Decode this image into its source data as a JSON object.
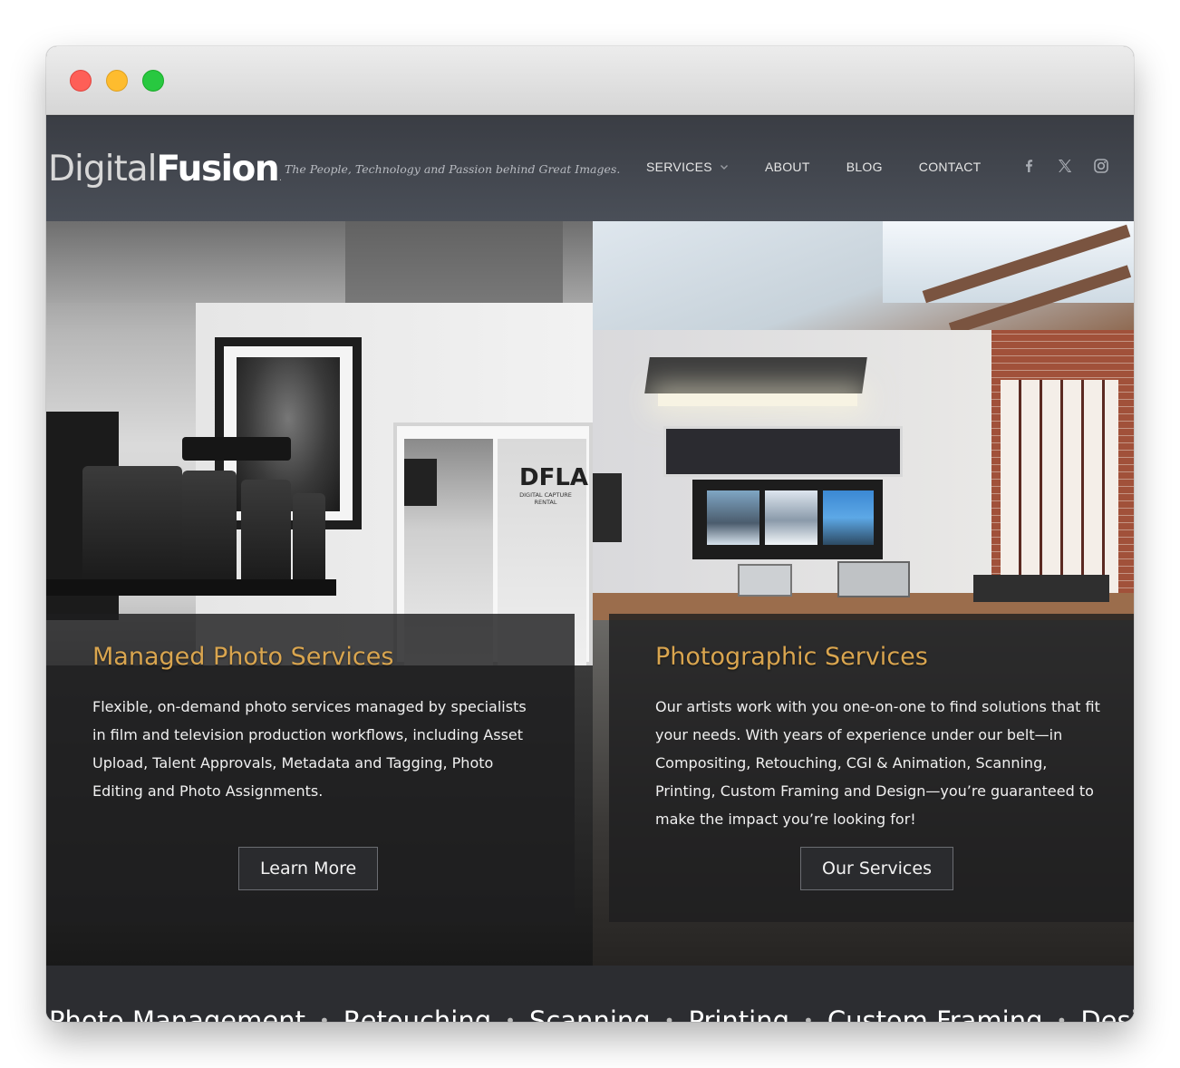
{
  "window": {
    "controls": [
      "close",
      "minimize",
      "zoom"
    ]
  },
  "header": {
    "logo_light": "Digital",
    "logo_bold": "Fusion",
    "logo_mark": ".",
    "tagline": "The People, Technology and Passion behind Great Images.",
    "nav": {
      "services": "SERVICES",
      "about": "ABOUT",
      "blog": "BLOG",
      "contact": "CONTACT"
    },
    "social_icons": [
      "facebook-icon",
      "x-icon",
      "instagram-icon"
    ]
  },
  "hero": {
    "left": {
      "title": "Managed Photo Services",
      "text": "Flexible, on-demand photo services managed by specialists in film and television production workflows, including Asset Upload, Talent Approvals, Metadata and Tagging, Photo Editing and Photo Assignments.",
      "button": "Learn More",
      "photo_sign": "DFLA",
      "photo_sign_sub": "DIGITAL CAPTURE RENTAL"
    },
    "right": {
      "title": "Photographic Services",
      "text": "Our artists work with you one-on-one to find solutions that fit your needs. With years of experience under our belt—in Compositing, Retouching, CGI & Animation, Scanning, Printing, Custom Framing and Design—you’re guaranteed to make the impact you’re looking for!",
      "button": "Our Services"
    }
  },
  "ticker": {
    "items": [
      "Photo Management",
      "Retouching",
      "Scanning",
      "Printing",
      "Custom Framing",
      "Design"
    ],
    "separator": "•"
  },
  "colors": {
    "accent_gold": "#d9a54f",
    "header_bg": "#3a3d44",
    "overlay_bg": "#1e1e20"
  }
}
